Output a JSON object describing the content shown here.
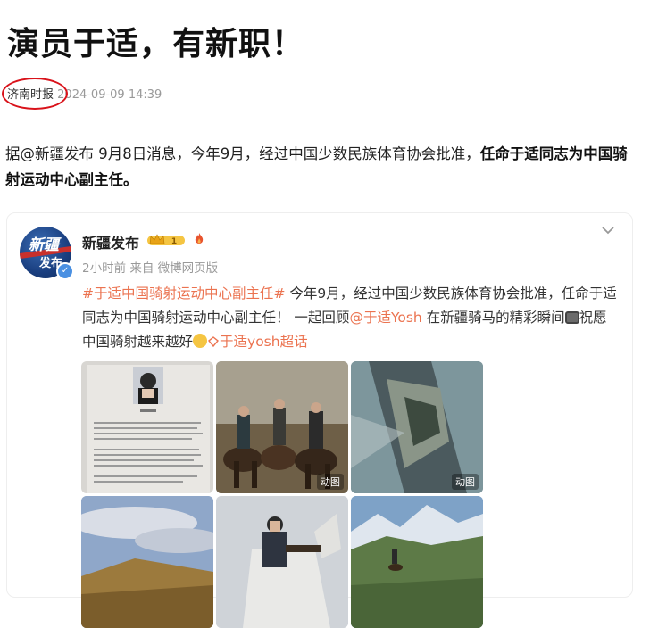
{
  "article": {
    "title": "演员于适，有新职！",
    "source": "济南时报",
    "timestamp": "2024-09-09 14:39",
    "para_normal": "据@新疆发布 9月8日消息，今年9月，经过中国少数民族体育协会批准，",
    "para_bold": "任命于适同志为中国骑射运动中心副主任。"
  },
  "post": {
    "avatar_text_top": "新疆",
    "avatar_text_bottom": "发布",
    "username": "新疆发布",
    "crown_level": "1",
    "time_source": "2小时前 来自 微博网页版",
    "hashtag": "#于适中国骑射运动中心副主任#",
    "body_1": " 今年9月，经过中国少数民族体育协会批准，任命于适同志为中国骑射运动中心副主任！ 一起回顾",
    "mention": "@于适Yosh",
    "body_2": " 在新疆骑马的精彩瞬间",
    "body_3": "祝愿中国骑射越来越好",
    "supertopic": "于适yosh超话",
    "gif_label": "动图"
  },
  "colors": {
    "accent": "#eb7350",
    "highlight_circle": "#d9121a",
    "verified": "#4a90e2"
  }
}
